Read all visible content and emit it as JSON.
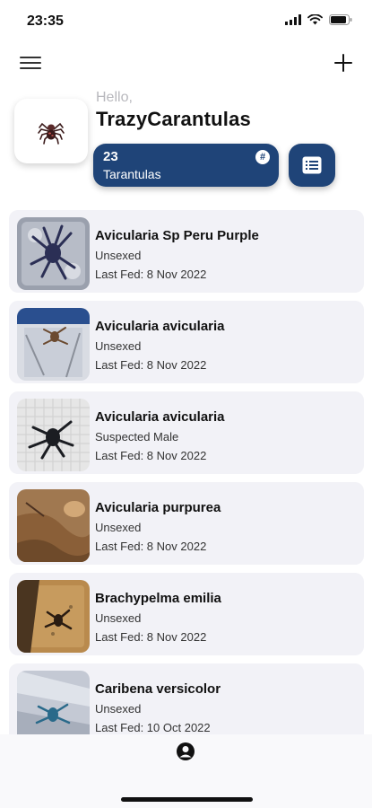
{
  "status_bar": {
    "time": "23:35"
  },
  "header": {
    "greeting": "Hello,",
    "username": "TrazyCarantulas"
  },
  "summary": {
    "count": "23",
    "label": "Tarantulas",
    "badge": "#"
  },
  "colors": {
    "accent": "#1f4478",
    "card_bg": "#f2f2f7"
  },
  "icons": {
    "menu": "hamburger-menu-icon",
    "add": "plus-icon",
    "list": "list-icon",
    "profile": "person-circle-icon",
    "avatar": "spider-icon"
  },
  "tarantulas": [
    {
      "species": "Avicularia Sp Peru Purple",
      "sex": "Unsexed",
      "last_fed": "Last Fed: 8 Nov 2022"
    },
    {
      "species": "Avicularia avicularia",
      "sex": "Unsexed",
      "last_fed": "Last Fed: 8 Nov 2022"
    },
    {
      "species": "Avicularia avicularia",
      "sex": "Suspected Male",
      "last_fed": "Last Fed: 8 Nov 2022"
    },
    {
      "species": "Avicularia purpurea",
      "sex": "Unsexed",
      "last_fed": "Last Fed: 8 Nov 2022"
    },
    {
      "species": "Brachypelma emilia",
      "sex": "Unsexed",
      "last_fed": "Last Fed: 8 Nov 2022"
    },
    {
      "species": "Caribena versicolor",
      "sex": "Unsexed",
      "last_fed": "Last Fed: 10 Oct 2022"
    }
  ]
}
